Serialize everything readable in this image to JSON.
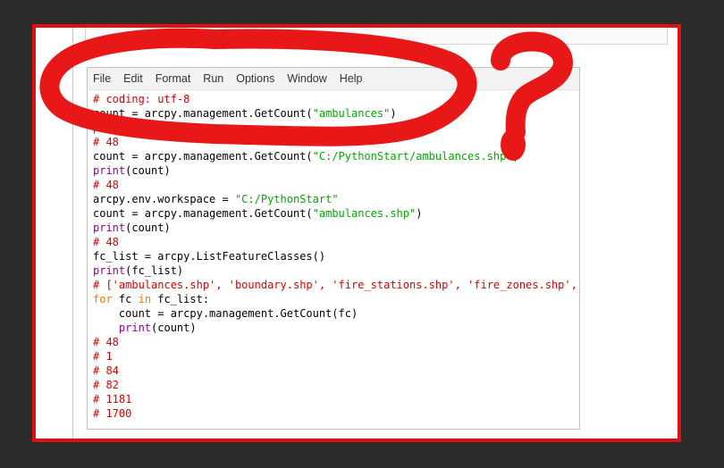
{
  "menu": [
    "File",
    "Edit",
    "Format",
    "Run",
    "Options",
    "Window",
    "Help"
  ],
  "code_lines": [
    [
      {
        "t": "# coding: utf-8",
        "c": "comment"
      }
    ],
    [
      {
        "t": "count = arcpy.management.GetCount(",
        "c": "plain"
      },
      {
        "t": "\"ambulances\"",
        "c": "string"
      },
      {
        "t": ")",
        "c": "plain"
      }
    ],
    [
      {
        "t": "print",
        "c": "builtin"
      },
      {
        "t": "(count)",
        "c": "plain"
      }
    ],
    [
      {
        "t": "# 48",
        "c": "comment"
      }
    ],
    [
      {
        "t": "count = arcpy.management.GetCount(",
        "c": "plain"
      },
      {
        "t": "\"C:/PythonStart/ambulances.shp\"",
        "c": "string"
      },
      {
        "t": ")",
        "c": "plain"
      }
    ],
    [
      {
        "t": "print",
        "c": "builtin"
      },
      {
        "t": "(count)",
        "c": "plain"
      }
    ],
    [
      {
        "t": "# 48",
        "c": "comment"
      }
    ],
    [
      {
        "t": "arcpy.env.workspace = ",
        "c": "plain"
      },
      {
        "t": "\"C:/PythonStart\"",
        "c": "string"
      }
    ],
    [
      {
        "t": "count = arcpy.management.GetCount(",
        "c": "plain"
      },
      {
        "t": "\"ambulances.shp\"",
        "c": "string"
      },
      {
        "t": ")",
        "c": "plain"
      }
    ],
    [
      {
        "t": "print",
        "c": "builtin"
      },
      {
        "t": "(count)",
        "c": "plain"
      }
    ],
    [
      {
        "t": "# 48",
        "c": "comment"
      }
    ],
    [
      {
        "t": "fc_list = arcpy.ListFeatureClasses()",
        "c": "plain"
      }
    ],
    [
      {
        "t": "print",
        "c": "builtin"
      },
      {
        "t": "(fc_list)",
        "c": "plain"
      }
    ],
    [
      {
        "t": "# ['ambulances.shp', 'boundary.shp', 'fire_stations.shp', 'fire_zones.shp', 'hydrants.shp']",
        "c": "comment"
      }
    ],
    [
      {
        "t": "for",
        "c": "keyword"
      },
      {
        "t": " fc ",
        "c": "plain"
      },
      {
        "t": "in",
        "c": "keyword"
      },
      {
        "t": " fc_list:",
        "c": "plain"
      }
    ],
    [
      {
        "t": "    count = arcpy.management.GetCount(fc)",
        "c": "plain"
      }
    ],
    [
      {
        "t": "    ",
        "c": "plain"
      },
      {
        "t": "print",
        "c": "builtin"
      },
      {
        "t": "(count)",
        "c": "plain"
      }
    ],
    [
      {
        "t": "# 48",
        "c": "comment"
      }
    ],
    [
      {
        "t": "# 1",
        "c": "comment"
      }
    ],
    [
      {
        "t": "# 84",
        "c": "comment"
      }
    ],
    [
      {
        "t": "# 82",
        "c": "comment"
      }
    ],
    [
      {
        "t": "# 1181",
        "c": "comment"
      }
    ],
    [
      {
        "t": "# 1700",
        "c": "comment"
      }
    ]
  ],
  "colors": {
    "background": "#2b2b2b",
    "frame_border": "#e01010",
    "annotation": "#e81818",
    "comment": "#dd0000",
    "string": "#00aa00",
    "builtin": "#900090",
    "keyword": "#ff7700"
  },
  "annotation": {
    "shape": "hand-drawn-loop-around-first-lines",
    "mark": "question-mark"
  }
}
